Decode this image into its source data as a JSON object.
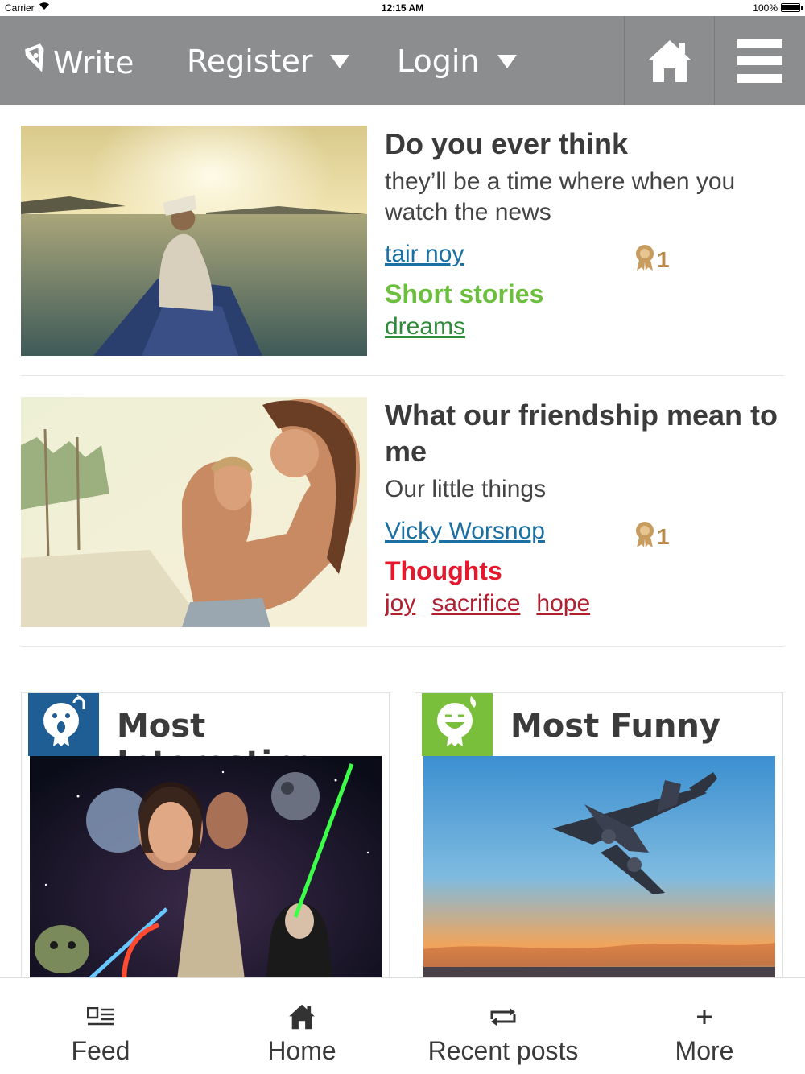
{
  "status_bar": {
    "carrier": "Carrier",
    "time": "12:15 AM",
    "battery": "100%"
  },
  "nav": {
    "write": "Write",
    "register": "Register",
    "login": "Login"
  },
  "posts": [
    {
      "title": "Do you ever think",
      "excerpt": "they’ll be a time where when you watch the news",
      "author": "tair noy",
      "awards": "1",
      "category": "Short stories",
      "category_color": "#6cbf3e",
      "tags": [
        "dreams"
      ],
      "tag_color": "#2e8b3a"
    },
    {
      "title": "What our friendship mean to me",
      "excerpt": "Our little things",
      "author": "Vicky Worsnop",
      "awards": "1",
      "category": "Thoughts",
      "category_color": "#e3192d",
      "tags": [
        "joy",
        "sacrifice",
        "hope"
      ],
      "tag_color": "#b02030"
    }
  ],
  "boxes": [
    {
      "title": "Most Interesting",
      "badge_color": "#1f5d95"
    },
    {
      "title": "Most Funny",
      "badge_color": "#7abf3c"
    }
  ],
  "tabs": [
    "Feed",
    "Home",
    "Recent posts",
    "More"
  ],
  "colors": {
    "nav_bg": "#8c8d8f",
    "link": "#1a6fa3",
    "award": "#b98a4a"
  }
}
